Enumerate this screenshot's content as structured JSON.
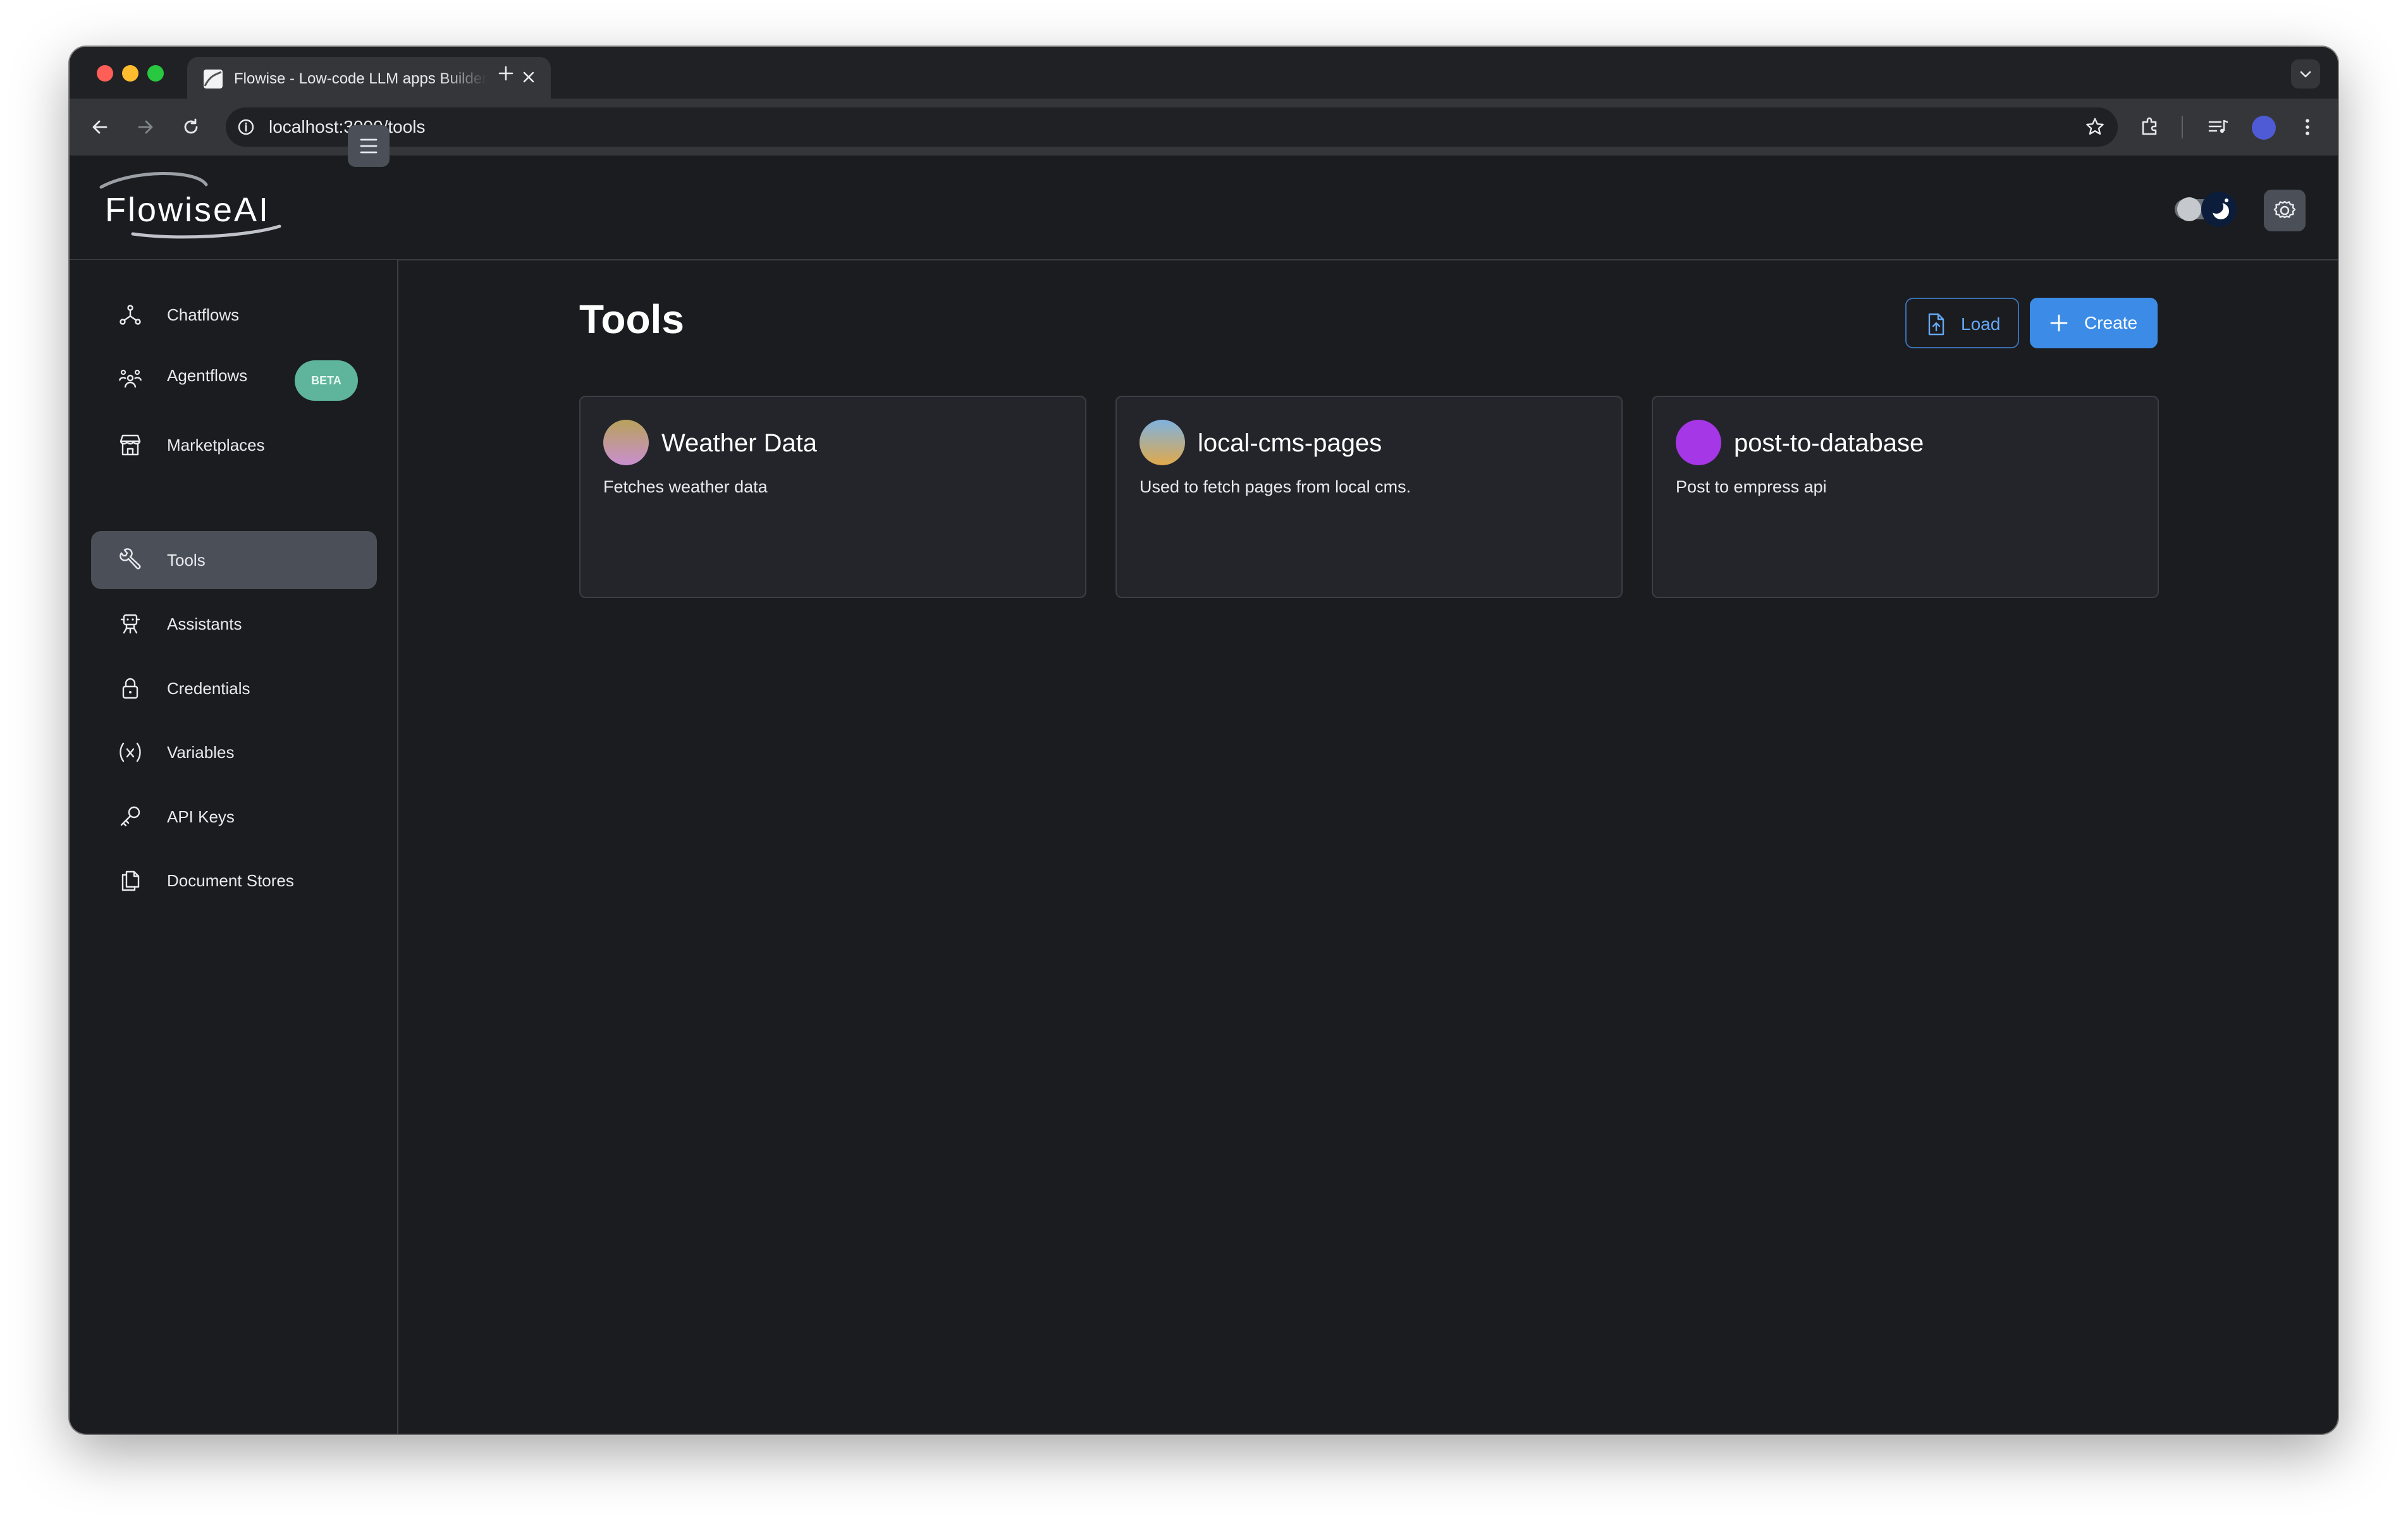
{
  "browser": {
    "tab_title": "Flowise - Low-code LLM apps Builder",
    "url": "localhost:3000/tools"
  },
  "app": {
    "logo_text": "FlowiseAI"
  },
  "sidebar": {
    "items": [
      {
        "label": "Chatflows",
        "icon": "chatflows-icon"
      },
      {
        "label": "Agentflows",
        "icon": "agentflows-icon",
        "badge": "BETA"
      },
      {
        "label": "Marketplaces",
        "icon": "marketplace-icon"
      },
      {
        "label": "Tools",
        "icon": "tools-icon",
        "active": true
      },
      {
        "label": "Assistants",
        "icon": "assistants-icon"
      },
      {
        "label": "Credentials",
        "icon": "lock-icon"
      },
      {
        "label": "Variables",
        "icon": "variables-icon"
      },
      {
        "label": "API Keys",
        "icon": "key-icon"
      },
      {
        "label": "Document Stores",
        "icon": "document-stores-icon"
      }
    ]
  },
  "main": {
    "title": "Tools",
    "load_label": "Load",
    "create_label": "Create",
    "cards": [
      {
        "name": "Weather Data",
        "description": "Fetches weather data",
        "avatar_colors": [
          "#b8a25a",
          "#c98fd0"
        ]
      },
      {
        "name": "local-cms-pages",
        "description": "Used to fetch pages from local cms.",
        "avatar_colors": [
          "#7fb2e0",
          "#e0a94a"
        ]
      },
      {
        "name": "post-to-database",
        "description": "Post to empress api",
        "avatar_colors": [
          "#a637e6",
          "#a637e6"
        ]
      }
    ]
  },
  "colors": {
    "background": "#1b1c20",
    "accent": "#3c8ce7",
    "beta_badge": "#5fb59c"
  }
}
